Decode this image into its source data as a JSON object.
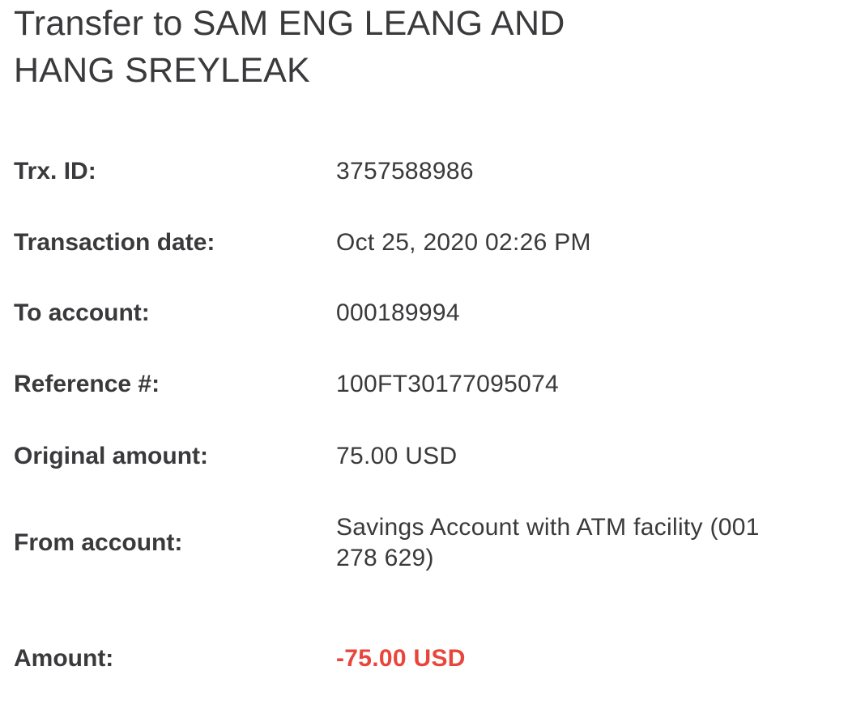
{
  "header": {
    "title_line1": "Transfer to SAM ENG LEANG AND",
    "title_line2": "HANG SREYLEAK"
  },
  "details": [
    {
      "label": "Trx. ID:",
      "value": "3757588986"
    },
    {
      "label": "Transaction date:",
      "value": "Oct 25, 2020 02:26 PM"
    },
    {
      "label": "To account:",
      "value": "000189994"
    },
    {
      "label": "Reference #:",
      "value": "100FT30177095074"
    },
    {
      "label": "Original amount:",
      "value": "75.00 USD"
    },
    {
      "label": "From account:",
      "value_line1": "Savings Account with ATM facility (001",
      "value_line2": "278 629)"
    },
    {
      "label": "Amount:",
      "value": "-75.00 USD"
    }
  ],
  "colors": {
    "text": "#3a3a3c",
    "negative_amount": "#e8463d",
    "background": "#ffffff"
  }
}
